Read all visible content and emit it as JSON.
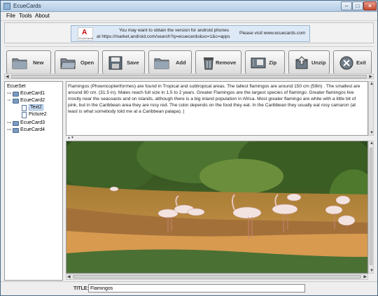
{
  "window": {
    "title": "EcueCards"
  },
  "menu": {
    "file": "File",
    "tools": "Tools",
    "about": "About"
  },
  "banner": {
    "logo_text": "EcueCards",
    "line1": "You may want to obtain the version for android phones",
    "line2": "at https://market.android.com/search?q=ecuecards&so=1&c=apps",
    "visit": "Please visit www.ecuecards.com"
  },
  "toolbar": {
    "new": "New",
    "open": "Open",
    "save": "Save",
    "add": "Add",
    "remove": "Remove",
    "zip": "Zip",
    "unzip": "Unzip",
    "exit": "Exit"
  },
  "tree": {
    "root": "EcueSet",
    "cards": [
      {
        "label": "EcueCard1"
      },
      {
        "label": "EcueCard2",
        "children": [
          {
            "label": "Text2"
          },
          {
            "label": "Picture2"
          }
        ]
      },
      {
        "label": "EcueCard3"
      },
      {
        "label": "EcueCard4"
      }
    ]
  },
  "content": {
    "text": "Flamingos (Phoenicopteriformes) are found in Tropical and subtropical areas. The tallest flamingos are around 150 cm (59in) . The smallest are around 80 cm. (31.5 in). Males reach full size in 1.5 to 2 years. Greater Flamingos are the largest species of flamingo. Greater flamingos live mostly near the seacoasts and on islands, although there is a big inland population in Africa. Most greater flamingo are white with a little bit of pink, but in the Caribbean area they are rosy red. The color depends on the food they eat. In the Caribbean they usually eat rosy camaron (at least is what somebody told me at a Caribbean palapa). |"
  },
  "footer": {
    "title_label": "TITLE:",
    "title_value": "Flamingos"
  }
}
